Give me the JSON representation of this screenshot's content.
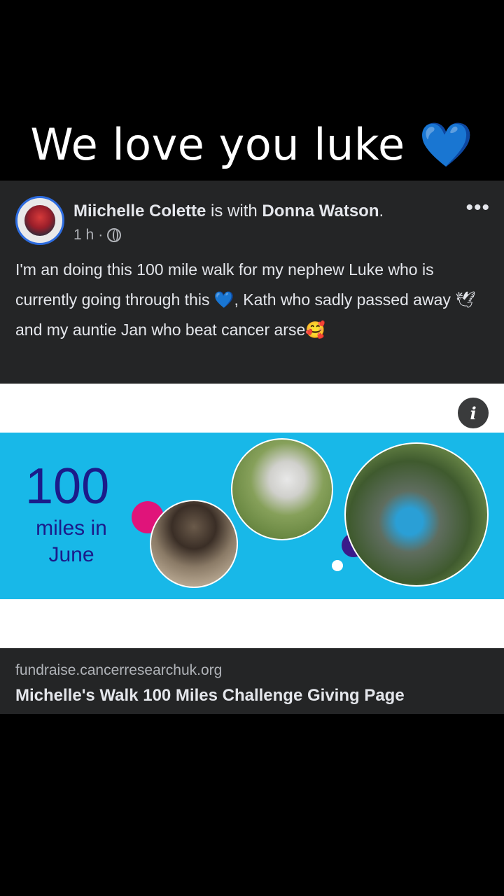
{
  "caption": {
    "text": "We love you luke",
    "emoji": "💙"
  },
  "post": {
    "author": "Miichelle Colette",
    "connector": " is with ",
    "tagged": "Donna Watson",
    "end": ".",
    "time": "1 h",
    "dot": "·",
    "privacy_icon": "globe-icon",
    "more_label": "•••",
    "text": "I'm an doing this 100 mile walk for my nephew Luke who is currently going through this 💙, Kath who sadly passed away 🕊 and my auntie Jan who beat cancer arse🥰"
  },
  "link_card": {
    "info_label": "i",
    "banner": {
      "number": "100",
      "line1": "miles in",
      "line2": "June"
    },
    "domain": "fundraise.cancerresearchuk.org",
    "title": "Michelle's Walk 100 Miles Challenge Giving Page"
  },
  "colors": {
    "heart": "#1877f2",
    "banner_bg": "#18b8e8",
    "banner_text": "#1b1b8a",
    "dot_pink": "#e0147a",
    "dot_purple": "#3a1a8a",
    "post_bg": "#242526"
  }
}
